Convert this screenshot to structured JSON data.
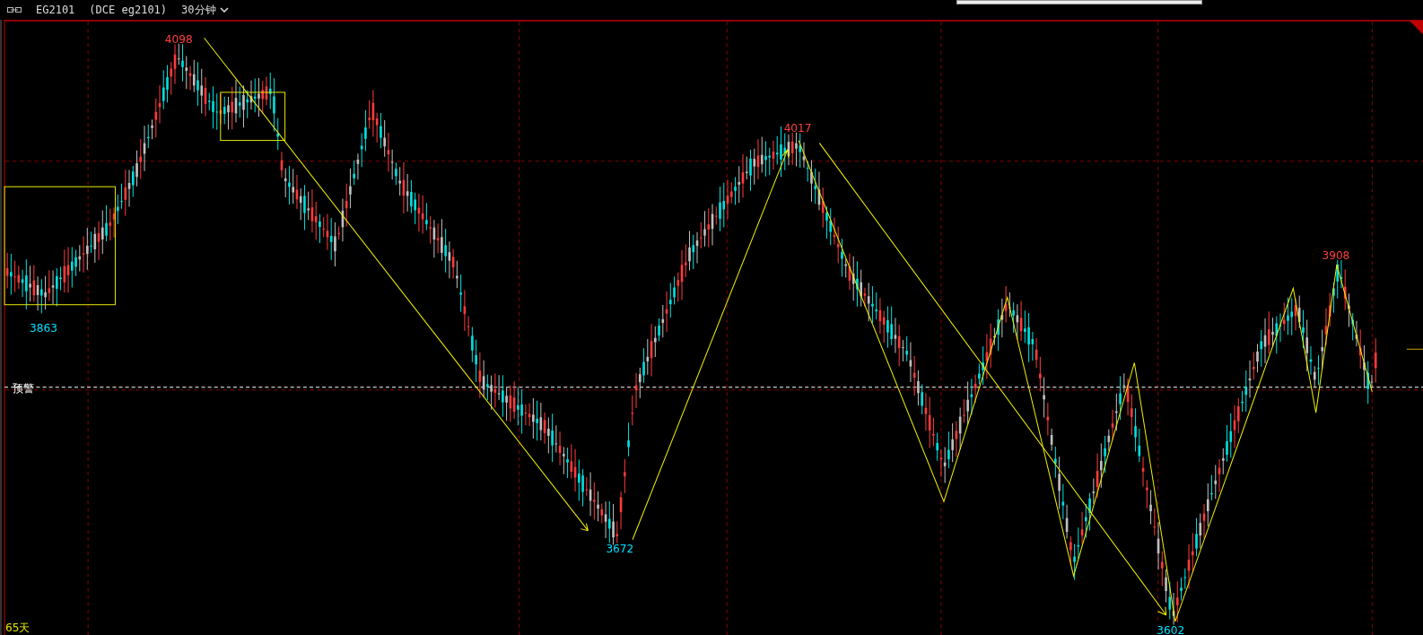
{
  "header": {
    "symbol": "EG2101",
    "exchange": "(DCE eg2101)",
    "period": "30分钟"
  },
  "price_labels": [
    {
      "text": "4098",
      "kind": "high"
    },
    {
      "text": "3863",
      "kind": "low"
    },
    {
      "text": "4017",
      "kind": "high"
    },
    {
      "text": "3672",
      "kind": "low"
    },
    {
      "text": "3908",
      "kind": "high"
    },
    {
      "text": "3602",
      "kind": "low"
    }
  ],
  "alert_line": {
    "label": "预警"
  },
  "footer": {
    "span": "65天"
  }
}
